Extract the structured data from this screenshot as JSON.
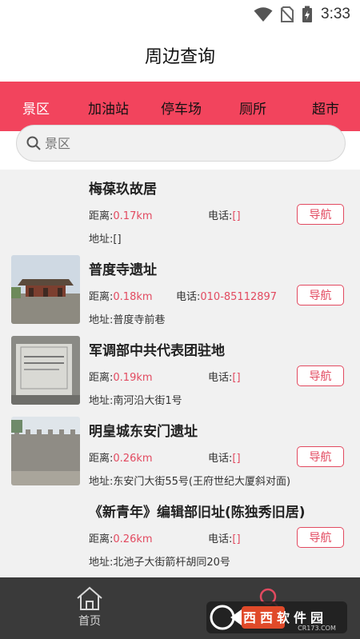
{
  "status": {
    "time": "3:33"
  },
  "header": {
    "title": "周边查询"
  },
  "tabs": [
    {
      "label": "景区",
      "active": true
    },
    {
      "label": "加油站",
      "active": false
    },
    {
      "label": "停车场",
      "active": false
    },
    {
      "label": "厕所",
      "active": false
    },
    {
      "label": "超市",
      "active": false
    }
  ],
  "search": {
    "placeholder": "景区",
    "value": ""
  },
  "colors": {
    "accent": "#f2445d",
    "link_red": "#e24a60",
    "bottom_bar": "#3a3a3a"
  },
  "items": [
    {
      "name": "梅葆玖故居",
      "dist_label": "距离:",
      "dist_value": "0.17km",
      "phone_label": "电话:",
      "phone_value": "[]",
      "addr_label": "地址:",
      "addr_value": "[]",
      "nav_label": "导航"
    },
    {
      "name": "普度寺遗址",
      "dist_label": "距离:",
      "dist_value": "0.18km",
      "phone_label": "电话:",
      "phone_value": "010-85112897",
      "addr_label": "地址:",
      "addr_value": "普度寺前巷",
      "nav_label": "导航"
    },
    {
      "name": "军调部中共代表团驻地",
      "dist_label": "距离:",
      "dist_value": "0.19km",
      "phone_label": "电话:",
      "phone_value": "[]",
      "addr_label": "地址:",
      "addr_value": "南河沿大街1号",
      "nav_label": "导航"
    },
    {
      "name": "明皇城东安门遗址",
      "dist_label": "距离:",
      "dist_value": "0.26km",
      "phone_label": "电话:",
      "phone_value": "[]",
      "addr_label": "地址:",
      "addr_value": "东安门大街55号(王府世纪大厦斜对面)",
      "nav_label": "导航"
    },
    {
      "name": "《新青年》编辑部旧址(陈独秀旧居)",
      "dist_label": "距离:",
      "dist_value": "0.26km",
      "phone_label": "电话:",
      "phone_value": "[]",
      "addr_label": "地址:",
      "addr_value": "北池子大街箭杆胡同20号",
      "nav_label": "导航"
    }
  ],
  "bottom_nav": {
    "home_label": "首页",
    "home_icon": "home-icon",
    "second_icon": "search-icon"
  },
  "watermark": {
    "brand": "西西软件园",
    "site": "CR173.COM"
  }
}
